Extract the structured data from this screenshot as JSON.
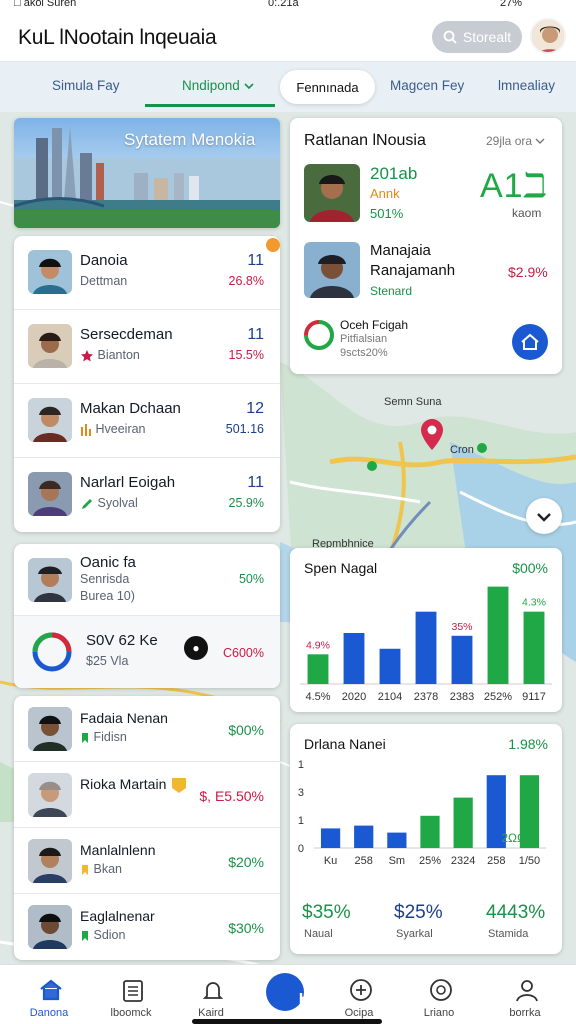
{
  "status": {
    "left": "□ akol Suren",
    "time": "0:.21a",
    "battery": "27%"
  },
  "header": {
    "title": "KuL lNootain lnqeuaia",
    "button_label": "Storealt"
  },
  "tabs": [
    {
      "label": "Simula Fay"
    },
    {
      "label": "Nndipond"
    },
    {
      "label": "Fennınada"
    },
    {
      "label": "Magcen Fey"
    },
    {
      "label": "lmnealiay"
    }
  ],
  "hero": {
    "title": "Sytatem Menokia"
  },
  "list1": [
    {
      "name": "Danoia",
      "sub": "Dettman",
      "num": "11",
      "pct": "26.8%",
      "pct_color": "red",
      "sub_icon": "none"
    },
    {
      "name": "Sersecdeman",
      "sub": "Bianton",
      "num": "11",
      "pct": "15.5%",
      "pct_color": "red",
      "sub_icon": "star-icon"
    },
    {
      "name": "Makan Dchaan",
      "sub": "Hveeiran",
      "num": "12",
      "pct": "501.16",
      "pct_color": "blue",
      "sub_icon": "bars-icon"
    },
    {
      "name": "Narlarl Eoigah",
      "sub": "Syolval",
      "num": "11",
      "pct": "25.9%",
      "pct_color": "green",
      "sub_icon": "pencil-icon"
    }
  ],
  "group2": {
    "row1": {
      "name": "Oanic fa",
      "sub1": "Senrisda",
      "sub2": "Burea 10)",
      "pct": "50%"
    },
    "row2": {
      "name": "S0V 62 Ke",
      "sub": "$25 Vla",
      "pct": "C600%"
    }
  },
  "list3": [
    {
      "name": "Fadaia Nenan",
      "sub": "Fidisn",
      "pct": "$00%",
      "pct_color": "green"
    },
    {
      "name": "Rioka Martain",
      "sub": "",
      "pct": "$, E5.50%",
      "pct_color": "red"
    },
    {
      "name": "Manlalnlenn",
      "sub": "Bkan",
      "pct": "$20%",
      "pct_color": "green"
    },
    {
      "name": "Eaglalnenar",
      "sub": "Sdion",
      "pct": "$30%",
      "pct_color": "green"
    }
  ],
  "right_card": {
    "title": "Ratlanan lNousia",
    "dropdown": "29jla ora",
    "p1": {
      "line1": "201ab",
      "line2": "Annk",
      "line3": "501%"
    },
    "big_code": "A1ℶ",
    "big_sub": "kaom",
    "p2": {
      "line1": "Manajaia",
      "line2": "Ranajamanh",
      "line3": "Stenard",
      "pct": "$2.9%"
    },
    "p3": {
      "line1": "Oceh Fcigah",
      "line2": "Pitfialsian",
      "line3": "9scts20%"
    }
  },
  "map_labels": {
    "town": "Semn Suna",
    "place": "Cron",
    "area": "Repmbhnice"
  },
  "chart_data": [
    {
      "type": "bar",
      "title": "Spen Nagal",
      "headline": "$00%",
      "categories": [
        "4.5%",
        "2020",
        "2104",
        "2378",
        "2383",
        "252%",
        "9117"
      ],
      "values": [
        32,
        55,
        38,
        78,
        52,
        105,
        78
      ],
      "colors": [
        "#1fa845",
        "#1b59d3",
        "#1b59d3",
        "#1b59d3",
        "#1b59d3",
        "#1fa845",
        "#1fa845"
      ],
      "annotations": [
        {
          "index": 0,
          "text": "4.9%",
          "color": "#c81b45"
        },
        {
          "index": 4,
          "text": "35%",
          "color": "#c81b45"
        },
        {
          "index": 6,
          "text": "4.3%",
          "color": "#1fa845"
        }
      ],
      "ylim": [
        0,
        110
      ]
    },
    {
      "type": "bar",
      "title": "Drlana Nanei",
      "headline": "1.98%",
      "categories": [
        "Ku",
        "258",
        "Sm",
        "25%",
        "2324",
        "258",
        "1/50"
      ],
      "values": [
        0.7,
        0.8,
        0.55,
        1.15,
        1.8,
        2.6,
        2.6
      ],
      "colors": [
        "#1b59d3",
        "#1b59d3",
        "#1b59d3",
        "#1fa845",
        "#1fa845",
        "#1b59d3",
        "#1fa845"
      ],
      "yticks": [
        "0",
        "1",
        "3",
        "1"
      ],
      "ylim": [
        0,
        3
      ],
      "overlay": "2ΩΩS",
      "stats": [
        {
          "value": "$35%",
          "label": "Naual",
          "color": "#1a9148"
        },
        {
          "value": "$25%",
          "label": "Syarkal",
          "color": "#1b3f8a"
        },
        {
          "value": "4443%",
          "label": "Stamida",
          "color": "#1a9148"
        }
      ]
    }
  ],
  "nav": [
    {
      "label": "Danona",
      "icon": "home-icon"
    },
    {
      "label": "lboomck",
      "icon": "list-icon"
    },
    {
      "label": "Kaird",
      "icon": "bell-icon"
    },
    {
      "label": "",
      "icon": "center-icon"
    },
    {
      "label": "Ocipa",
      "icon": "plus-icon"
    },
    {
      "label": "Lriano",
      "icon": "at-icon"
    },
    {
      "label": "borrka",
      "icon": "user-icon"
    }
  ],
  "colors": {
    "blue": "#1b59d3",
    "green": "#1fa845",
    "red": "#c81b45",
    "nav_active": "#1b59d3"
  }
}
